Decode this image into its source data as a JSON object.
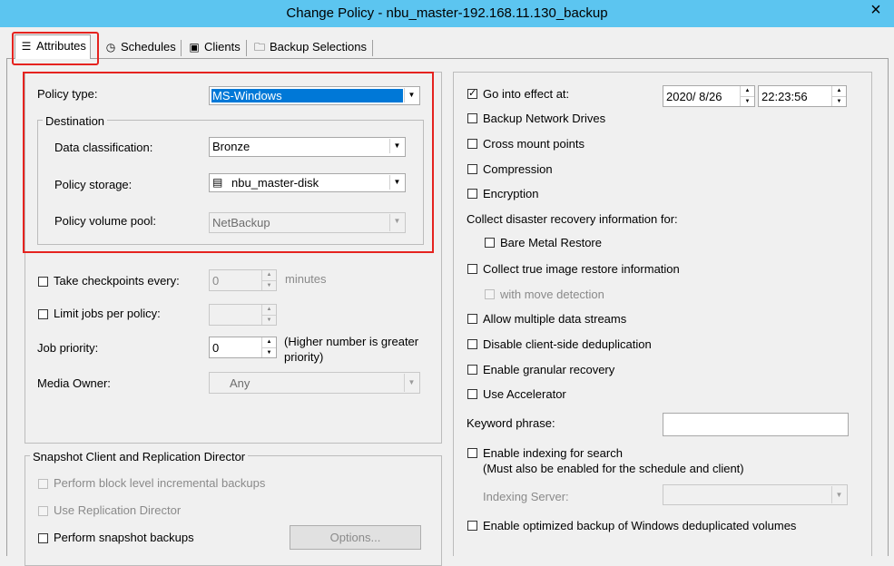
{
  "window": {
    "title": "Change Policy - nbu_master-192.168.11.130_backup",
    "close_glyph": "×"
  },
  "tabs": [
    {
      "label": "Attributes",
      "icon": "list-icon"
    },
    {
      "label": "Schedules",
      "icon": "clock-icon"
    },
    {
      "label": "Clients",
      "icon": "computer-icon"
    },
    {
      "label": "Backup Selections",
      "icon": "folder-icon"
    }
  ],
  "left": {
    "policy_type_label": "Policy type:",
    "policy_type_value": "MS-Windows",
    "destination_label": "Destination",
    "data_classification_label": "Data classification:",
    "data_classification_value": "Bronze",
    "policy_storage_label": "Policy storage:",
    "policy_storage_value": "nbu_master-disk",
    "policy_volume_pool_label": "Policy volume pool:",
    "policy_volume_pool_value": "NetBackup",
    "take_checkpoints_label": "Take checkpoints every:",
    "take_checkpoints_value": "0",
    "minutes_label": "minutes",
    "limit_jobs_label": "Limit jobs per policy:",
    "limit_jobs_value": "",
    "job_priority_label": "Job priority:",
    "job_priority_value": "0",
    "job_priority_hint_1": "(Higher number is greater",
    "job_priority_hint_2": "priority)",
    "media_owner_label": "Media Owner:",
    "media_owner_value": "Any",
    "snapshot_group_label": "Snapshot Client and Replication Director",
    "perform_block_label": "Perform block level incremental backups",
    "use_replication_label": "Use Replication Director",
    "perform_snapshot_label": "Perform snapshot backups",
    "options_button": "Options..."
  },
  "right": {
    "go_into_effect_label": "Go into effect at:",
    "go_into_effect_date": "2020/  8/26",
    "go_into_effect_time": "22:23:56",
    "backup_network_drives": "Backup Network Drives",
    "cross_mount_points": "Cross mount points",
    "compression": "Compression",
    "encryption": "Encryption",
    "collect_dr_label": "Collect disaster recovery information for:",
    "bare_metal_restore": "Bare Metal Restore",
    "collect_tir": "Collect true image restore information",
    "with_move_detection": "with move detection",
    "allow_multiple_streams": "Allow multiple data streams",
    "disable_client_dedup": "Disable client-side deduplication",
    "enable_granular": "Enable granular recovery",
    "use_accelerator": "Use Accelerator",
    "keyword_phrase_label": "Keyword phrase:",
    "keyword_phrase_value": "",
    "enable_indexing": "Enable indexing for search",
    "enable_indexing_note": "(Must also be enabled for the schedule and client)",
    "indexing_server_label": "Indexing Server:",
    "indexing_server_value": "",
    "enable_optimized": "Enable optimized backup of Windows deduplicated volumes"
  },
  "states": {
    "go_into_effect": true,
    "backup_network_drives": false,
    "cross_mount_points": false,
    "compression": false,
    "encryption": false,
    "bare_metal_restore": false,
    "collect_tir": false,
    "with_move_detection": false,
    "allow_multiple_streams": false,
    "disable_client_dedup": false,
    "enable_granular": false,
    "use_accelerator": false,
    "enable_indexing": false,
    "enable_optimized": false,
    "take_checkpoints": false,
    "limit_jobs": false,
    "perform_block": false,
    "use_replication": false,
    "perform_snapshot": false
  },
  "colors": {
    "title_bar": "#5cc5f0",
    "selection": "#0078d7",
    "highlight_box": "#e5231f"
  }
}
